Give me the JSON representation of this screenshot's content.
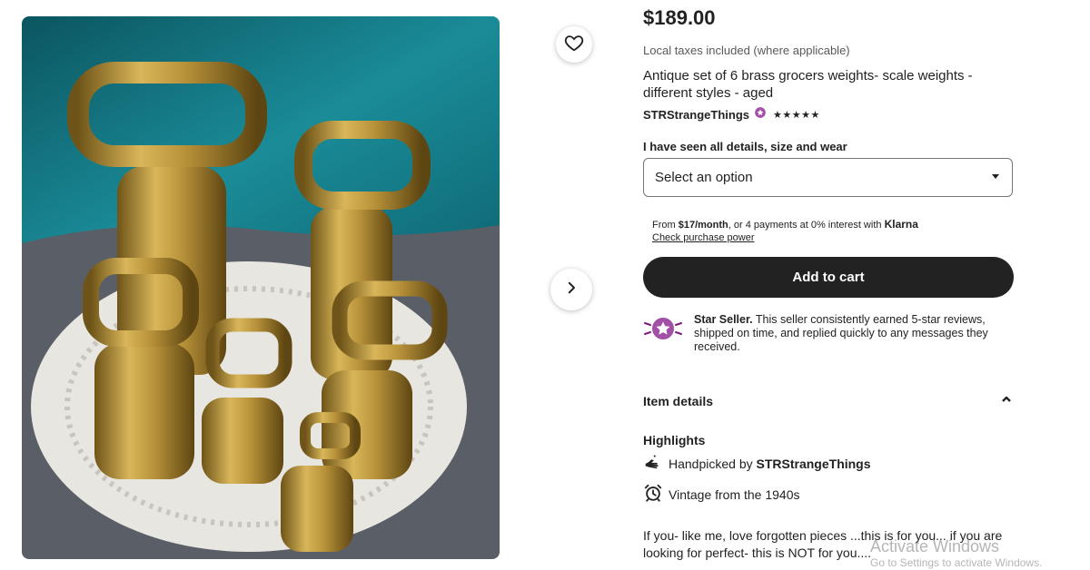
{
  "listing": {
    "price": "$189.00",
    "taxes_note": "Local taxes included (where applicable)",
    "title": "Antique set of 6 brass grocers weights- scale weights - different styles - aged",
    "seller_name": "STRStrangeThings",
    "rating_stars": "★★★★★",
    "variation_label": "I have seen all details, size and wear",
    "variation_selected": "Select an option",
    "klarna": {
      "prefix": "From ",
      "amount": "$17/month",
      "suffix": ", or 4 payments at 0% interest with ",
      "brand": "Klarna",
      "link": "Check purchase power"
    },
    "add_to_cart": "Add to cart",
    "star_seller": {
      "heading": "Star Seller.",
      "body": " This seller consistently earned 5-star reviews, shipped on time, and replied quickly to any messages they received."
    },
    "item_details": "Item details",
    "highlights": {
      "heading": "Highlights",
      "handpicked_prefix": "Handpicked by ",
      "handpicked_by": "STRStrangeThings",
      "vintage": "Vintage from the 1940s"
    },
    "description": "If you- like me, love forgotten pieces ...this is for you... if you are looking for perfect- this is NOT for you...."
  },
  "os_watermark": {
    "title": "Activate Windows",
    "subtitle": "Go to Settings to activate Windows."
  },
  "icons": {
    "favorite": "heart-icon",
    "next": "chevron-right-icon",
    "dropdown": "caret-down-icon",
    "collapse": "chevron-up-icon",
    "star_seller": "star-seller-badge-icon",
    "handpicked": "hand-icon",
    "vintage": "alarm-clock-icon"
  },
  "colors": {
    "accent_dark": "#222222",
    "star_seller_purple": "#7f187f",
    "photo_teal": "#0f6b78",
    "brass": "#b8923a"
  }
}
